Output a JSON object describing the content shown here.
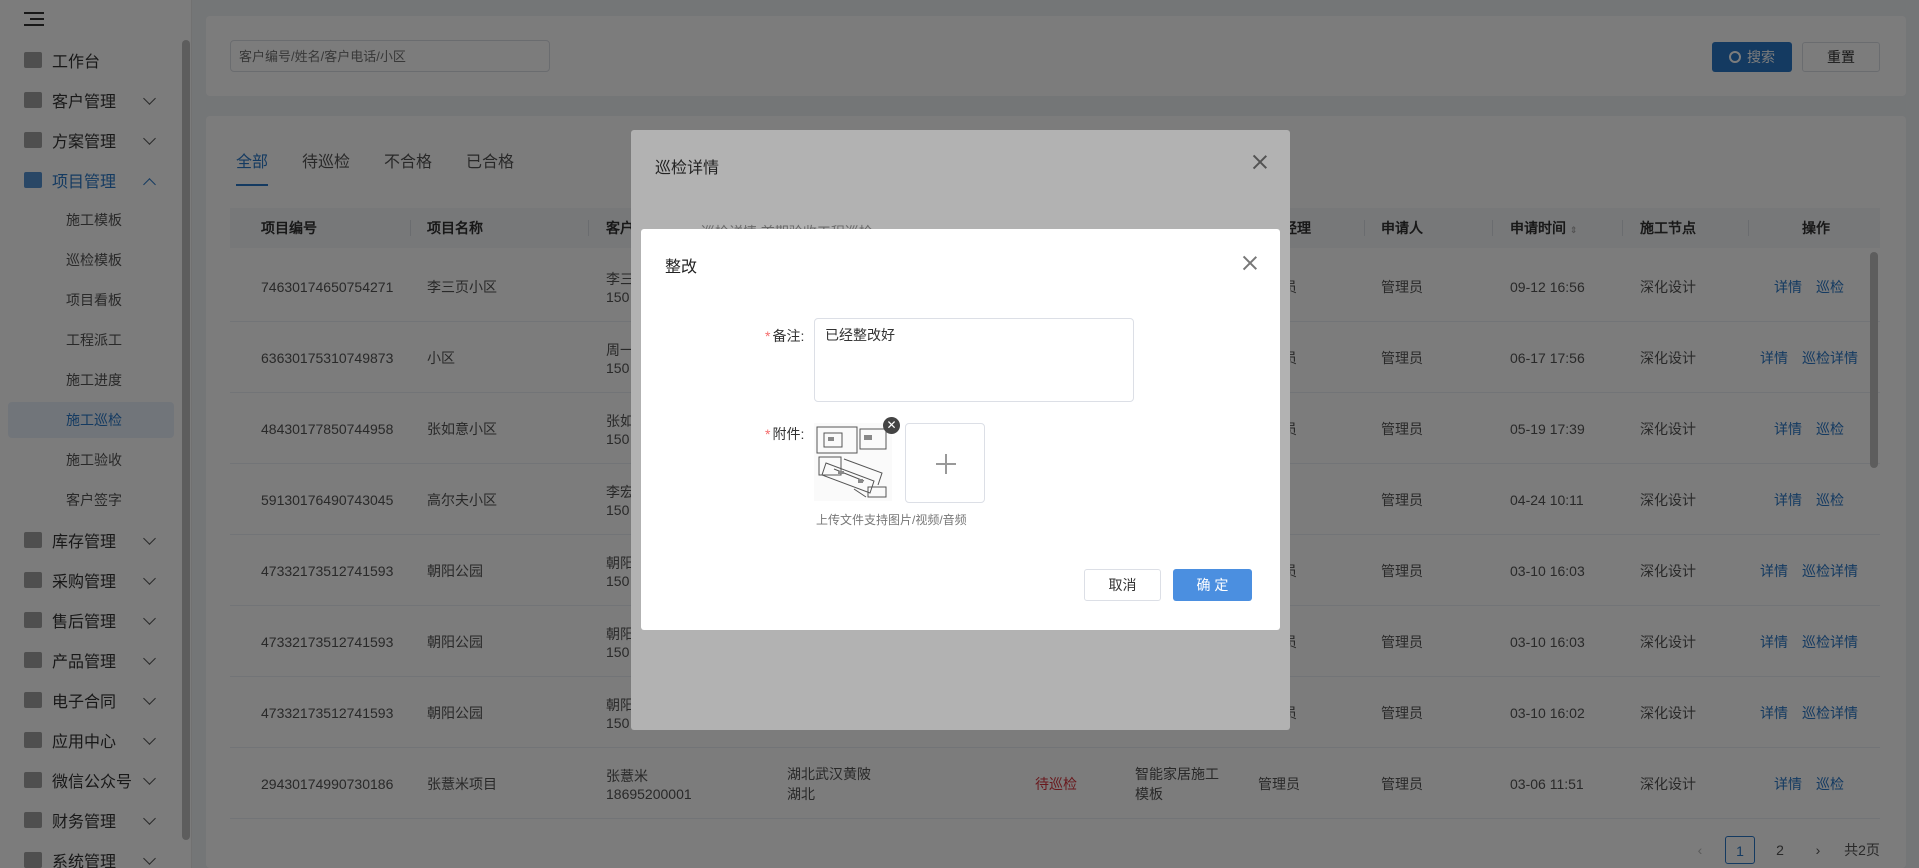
{
  "sidebar": {
    "items": [
      {
        "label": "工作台",
        "icon": "home-icon",
        "expandable": false
      },
      {
        "label": "客户管理",
        "icon": "customer-icon",
        "expandable": true
      },
      {
        "label": "方案管理",
        "icon": "plan-icon",
        "expandable": true
      },
      {
        "label": "项目管理",
        "icon": "folder-icon",
        "expandable": true,
        "open": true
      },
      {
        "label": "库存管理",
        "icon": "inventory-icon",
        "expandable": true
      },
      {
        "label": "采购管理",
        "icon": "cart-icon",
        "expandable": true
      },
      {
        "label": "售后管理",
        "icon": "headset-icon",
        "expandable": true
      },
      {
        "label": "产品管理",
        "icon": "product-icon",
        "expandable": true
      },
      {
        "label": "电子合同",
        "icon": "contract-icon",
        "expandable": true
      },
      {
        "label": "应用中心",
        "icon": "apps-icon",
        "expandable": true
      },
      {
        "label": "微信公众号",
        "icon": "wechat-icon",
        "expandable": true
      },
      {
        "label": "财务管理",
        "icon": "finance-icon",
        "expandable": true
      },
      {
        "label": "系统管理",
        "icon": "settings-icon",
        "expandable": true
      }
    ],
    "sub_items": [
      "施工模板",
      "巡检模板",
      "项目看板",
      "工程派工",
      "施工进度",
      "施工巡检",
      "施工验收",
      "客户签字"
    ],
    "active_sub": "施工巡检"
  },
  "search": {
    "placeholder": "客户编号/姓名/客户电话/小区",
    "search_label": "搜索",
    "reset_label": "重置"
  },
  "tabs": [
    "全部",
    "待巡检",
    "不合格",
    "已合格"
  ],
  "table": {
    "headers": {
      "code": "项目编号",
      "name": "项目名称",
      "customer": "客户",
      "manager": "经理",
      "applicant": "申请人",
      "time": "申请时间",
      "node": "施工节点",
      "ops": "操作"
    },
    "rows": [
      {
        "code": "74630174650754271",
        "name": "李三页小区",
        "customer": "李三",
        "phone": "150",
        "manager": "员",
        "applicant": "管理员",
        "time": "09-12 16:56",
        "node": "深化设计",
        "ops": [
          "详情",
          "巡检"
        ]
      },
      {
        "code": "63630175310749873",
        "name": "小区",
        "customer": "周一",
        "phone": "150",
        "manager": "员",
        "applicant": "管理员",
        "time": "06-17 17:56",
        "node": "深化设计",
        "ops": [
          "详情",
          "巡检详情"
        ]
      },
      {
        "code": "48430177850744958",
        "name": "张如意小区",
        "customer": "张如",
        "phone": "150",
        "manager": "员",
        "applicant": "管理员",
        "time": "05-19 17:39",
        "node": "深化设计",
        "ops": [
          "详情",
          "巡检"
        ]
      },
      {
        "code": "59130176490743045",
        "name": "高尔夫小区",
        "customer": "李宏",
        "phone": "150",
        "manager": "",
        "applicant": "管理员",
        "time": "04-24 10:11",
        "node": "深化设计",
        "ops": [
          "详情",
          "巡检"
        ]
      },
      {
        "code": "47332173512741593",
        "name": "朝阳公园",
        "customer": "朝阳",
        "phone": "150",
        "manager": "员",
        "applicant": "管理员",
        "time": "03-10 16:03",
        "node": "深化设计",
        "ops": [
          "详情",
          "巡检详情"
        ]
      },
      {
        "code": "47332173512741593",
        "name": "朝阳公园",
        "customer": "朝阳",
        "phone": "150",
        "manager": "员",
        "applicant": "管理员",
        "time": "03-10 16:03",
        "node": "深化设计",
        "ops": [
          "详情",
          "巡检详情"
        ]
      },
      {
        "code": "47332173512741593",
        "name": "朝阳公园",
        "customer": "朝阳",
        "phone": "150",
        "manager": "员",
        "applicant": "管理员",
        "time": "03-10 16:02",
        "node": "深化设计",
        "ops": [
          "详情",
          "巡检详情"
        ]
      },
      {
        "code": "29430174990730186",
        "name": "张薏米项目",
        "customer": "张薏米",
        "phone": "18695200001",
        "address": "湖北武汉黄陂",
        "address2": "湖北",
        "status": "待巡检",
        "template": "智能家居施工",
        "template2": "模板",
        "manager": "管理员",
        "applicant": "管理员",
        "time": "03-06 11:51",
        "node": "深化设计",
        "ops": [
          "详情",
          "巡检"
        ]
      }
    ]
  },
  "pagination": {
    "pages": [
      "1",
      "2"
    ],
    "current": "1",
    "total": "共2页"
  },
  "inspection_dialog": {
    "title": "巡检详情",
    "subtabs": "巡检详情    首期验收工程巡检"
  },
  "rectify_dialog": {
    "title": "整改",
    "remark_label": "备注:",
    "remark_value": "已经整改好",
    "attachment_label": "附件:",
    "hint": "上传文件支持图片/视频/音频",
    "cancel_label": "取消",
    "ok_label": "确 定"
  },
  "colors": {
    "accent": "#2a78c8",
    "ok_button": "#4b8fe0",
    "danger": "#d9363e"
  }
}
